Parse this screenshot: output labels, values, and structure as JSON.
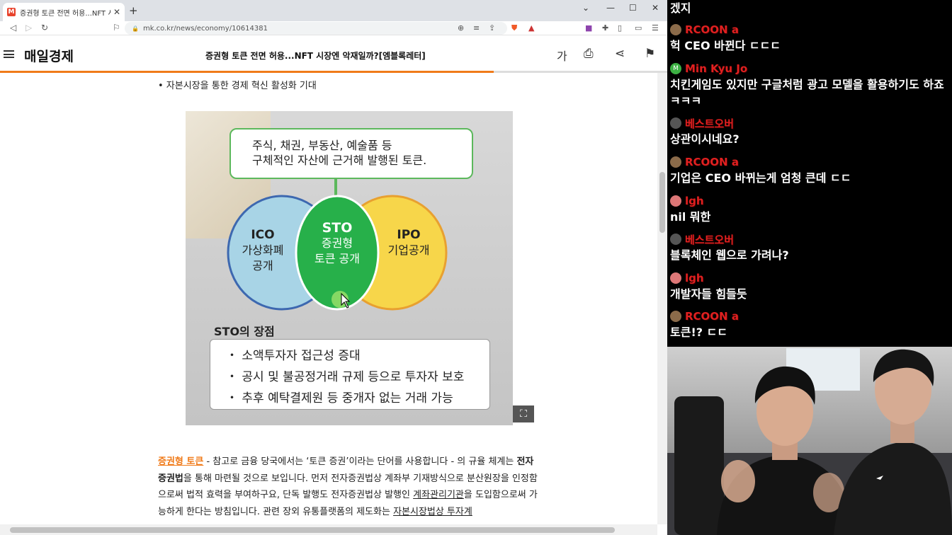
{
  "browser": {
    "tab_title": "증권형 토큰 전면 허용...NFT 시장엔 악재일까?[엠블록레터]",
    "favicon_letter": "M",
    "url": "mk.co.kr/news/economy/10614381"
  },
  "site": {
    "logo": "매일경제",
    "headline": "증권형 토큰 전면 허용...NFT 시장엔 악재일까?[엠블록레터]",
    "font_size_label": "가",
    "reading_progress_pct": 74
  },
  "article": {
    "bullet": "• 자본시장을 통한 경제 혁신 활성화 기대",
    "figure": {
      "callout_lines": [
        "주식, 채권, 부동산, 예술품 등",
        "구체적인 자산에 근거해 발행된 토큰."
      ],
      "ico_title": "ICO",
      "ico_lines": [
        "가상화폐",
        "공개"
      ],
      "sto_title": "STO",
      "sto_lines": [
        "증권형",
        "토큰 공개"
      ],
      "ipo_title": "IPO",
      "ipo_lines": [
        "기업공개"
      ],
      "advantages_title": "STO의 장점",
      "advantages": [
        "・ 소액투자자 접근성 증대",
        "・ 공시 및 불공정거래 규제 등으로 투자자 보호",
        "・ 추후 예탁결제원 등 중개자 없는 거래 가능"
      ]
    },
    "para": {
      "keyword": "증권형 토큰",
      "t1": " - 참고로 금융 당국에서는 ‘토큰 증권’이라는 단어를 사용합니다 - 의 규율 체계는 ",
      "b1": "전자증권법",
      "t2": "을 통해 마련될 것으로 보입니다. 먼저 전자증권법상 계좌부 기재방식으로 분산원장을 인정함으로써 법적 효력을 부여하구요, 단독 발행도 전자증권법상 발행인 ",
      "u1": "계좌관리기관",
      "t3": "을 도입함으로써 가능하게 한다는 방침입니다. 관련 장외 유통플랫폼의 제도화는 ",
      "u2": "자본시장법상 투자계"
    }
  },
  "chat": [
    {
      "user": "",
      "text": "겠지",
      "avatar_color": "#888"
    },
    {
      "user": "RCOON a",
      "text": "헉 CEO 바뀐다 ㄷㄷㄷ",
      "avatar_color": "#8b6b4a"
    },
    {
      "user": "Min Kyu Jo",
      "text": "치킨게임도 있지만 구글처럼 광고 모델을 활용하기도 하죠 ㅋㅋㅋ",
      "avatar_color": "#3cb043",
      "avatar_letter": "M"
    },
    {
      "user": "베스트오버",
      "text": "상관이시네요?",
      "avatar_color": "#555"
    },
    {
      "user": "RCOON a",
      "text": "기업은 CEO 바뀌는게 엄청 큰데 ㄷㄷ",
      "avatar_color": "#8b6b4a"
    },
    {
      "user": "lgh",
      "text": "nil 뭐한",
      "avatar_color": "#d77"
    },
    {
      "user": "베스트오버",
      "text": "블록체인 웹으로 가려나?",
      "avatar_color": "#555"
    },
    {
      "user": "lgh",
      "text": "개발자들 힘들듯",
      "avatar_color": "#d77"
    },
    {
      "user": "RCOON a",
      "text": "토큰!? ㄷㄷ",
      "avatar_color": "#8b6b4a"
    }
  ]
}
